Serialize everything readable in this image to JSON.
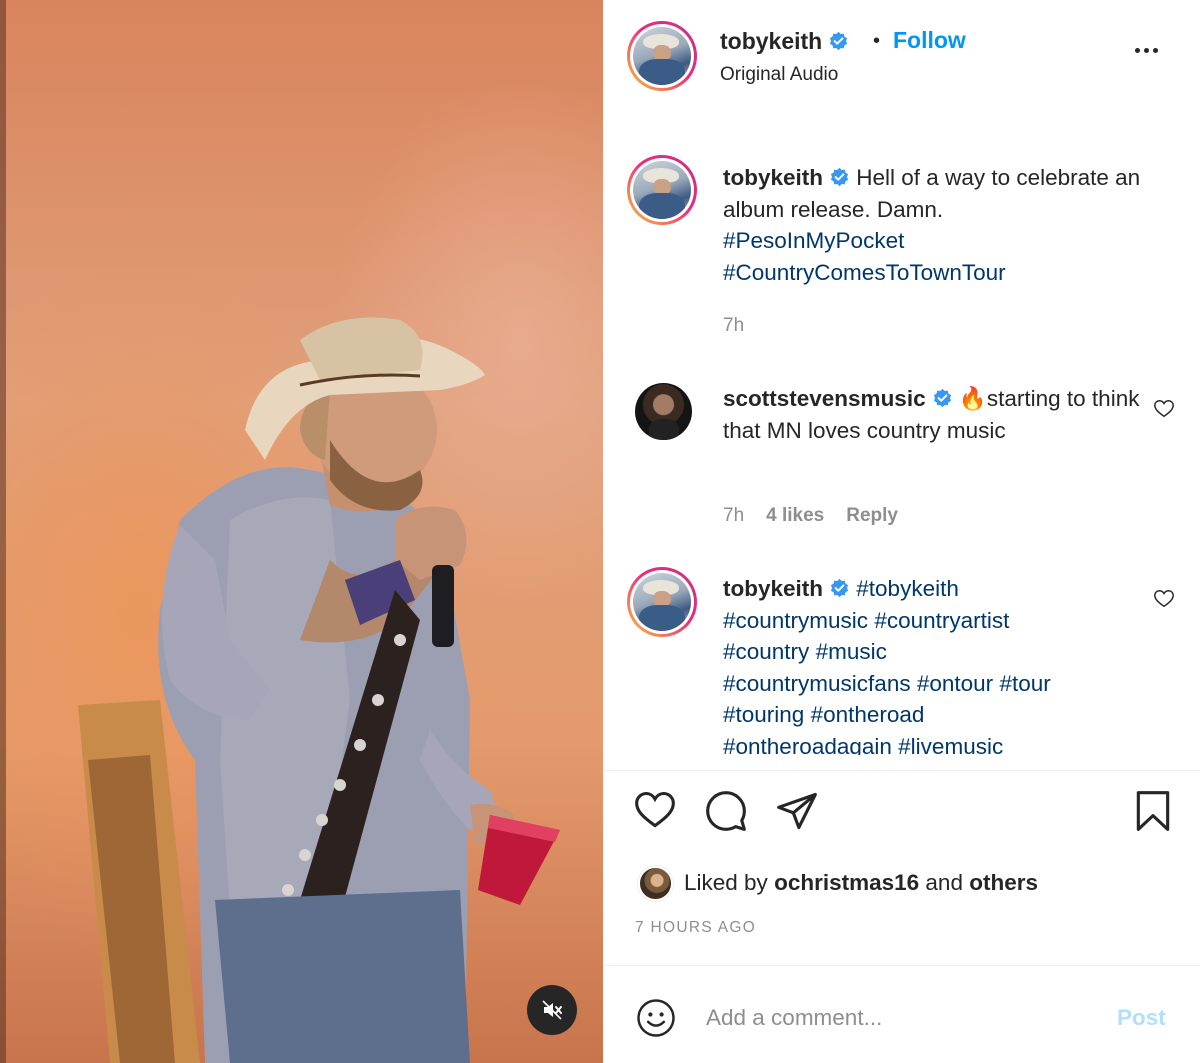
{
  "post": {
    "author": "tobykeith",
    "follow_label": "Follow",
    "separator": "•",
    "audio_label": "Original Audio"
  },
  "caption": {
    "username": "tobykeith",
    "text": "Hell of a way to celebrate an album release. Damn.",
    "hashtags": [
      "#PesoInMyPocket",
      "#CountryComesToTownTour"
    ],
    "time": "7h"
  },
  "comments": [
    {
      "username": "scottstevensmusic",
      "emoji": "🔥",
      "text": "starting to think that MN loves country music",
      "time": "7h",
      "likes": "4 likes",
      "reply_label": "Reply"
    },
    {
      "username": "tobykeith",
      "hashtags": [
        "#tobykeith",
        "#countrymusic",
        "#countryartist",
        "#country",
        "#music",
        "#countrymusicfans",
        "#ontour",
        "#tour",
        "#touring",
        "#ontheroad",
        "#ontheroadagain",
        "#livemusic"
      ]
    }
  ],
  "likes": {
    "prefix": "Liked by",
    "user": "ochristmas16",
    "conjunction": "and",
    "others": "others"
  },
  "timestamp": "7 HOURS AGO",
  "composer": {
    "placeholder": "Add a comment...",
    "post_label": "Post"
  },
  "colors": {
    "link_blue": "#0095f6",
    "hashtag_blue": "#00376b",
    "verified_blue": "#3897f0",
    "muted_gray": "#8e8e8e",
    "post_disabled": "#b2dffc"
  },
  "icons": {
    "verified": "verified-badge-icon",
    "more": "more-options-icon",
    "like": "heart-icon",
    "comment": "comment-bubble-icon",
    "share": "paper-plane-icon",
    "save": "bookmark-icon",
    "emoji": "smiley-icon",
    "mute": "speaker-muted-icon"
  }
}
